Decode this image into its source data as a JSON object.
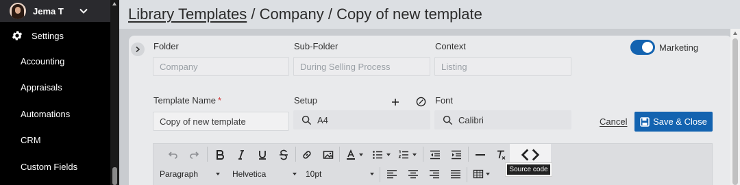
{
  "sidebar": {
    "user_name": "Jema T",
    "settings_label": "Settings",
    "items": [
      {
        "label": "Accounting"
      },
      {
        "label": "Appraisals"
      },
      {
        "label": "Automations"
      },
      {
        "label": "CRM"
      },
      {
        "label": "Custom Fields"
      }
    ]
  },
  "header": {
    "crumb_link": "Library Templates",
    "crumb_rest": " / Company / Copy of new template"
  },
  "form": {
    "folder_label": "Folder",
    "folder_placeholder": "Company",
    "subfolder_label": "Sub-Folder",
    "subfolder_placeholder": "During Selling Process",
    "context_label": "Context",
    "context_placeholder": "Listing",
    "marketing_label": "Marketing",
    "marketing_on": true,
    "template_name_label": "Template Name",
    "required_mark": "*",
    "template_name_value": "Copy of new template",
    "setup_label": "Setup",
    "setup_value": "A4",
    "font_label": "Font",
    "font_value": "Calibri",
    "cancel_label": "Cancel",
    "save_label": "Save & Close"
  },
  "editor": {
    "block_format": "Paragraph",
    "font_family": "Helvetica",
    "font_size": "10pt",
    "source_tooltip": "Source code"
  },
  "colors": {
    "accent": "#1363b0",
    "required": "#d32f2f"
  }
}
